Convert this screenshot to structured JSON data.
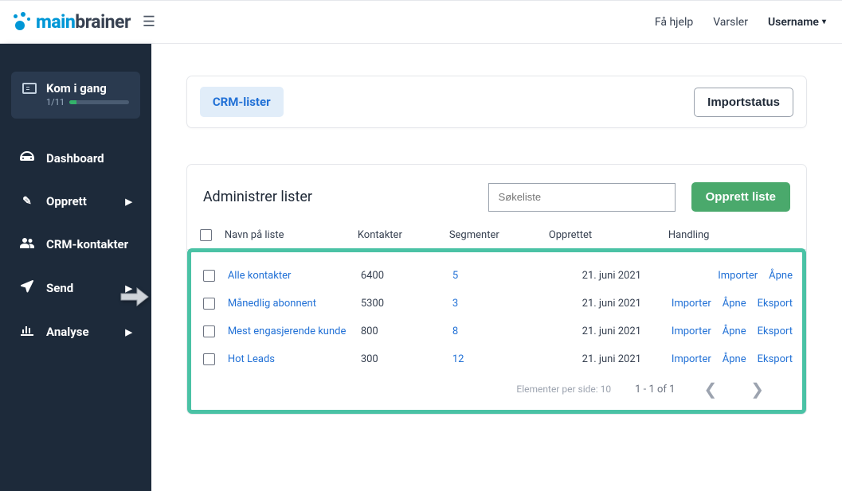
{
  "brand": {
    "part1": "main",
    "part2": "brainer"
  },
  "topbar": {
    "help": "Få hjelp",
    "alerts": "Varsler",
    "user": "Username"
  },
  "onboard": {
    "title": "Kom i gang",
    "progress": "1/11"
  },
  "nav": {
    "dashboard": "Dashboard",
    "create": "Opprett",
    "crm": "CRM-kontakter",
    "send": "Send",
    "analyse": "Analyse"
  },
  "header": {
    "pill": "CRM-lister",
    "import_status": "Importstatus"
  },
  "panel": {
    "title": "Administrer lister",
    "search_placeholder": "Søkeliste",
    "create_btn": "Opprett liste"
  },
  "columns": {
    "name": "Navn på liste",
    "contacts": "Kontakter",
    "segments": "Segmenter",
    "created": "Opprettet",
    "action": "Handling"
  },
  "actions": {
    "import": "Importer",
    "open": "Åpne",
    "export": "Eksport"
  },
  "rows": [
    {
      "name": "Alle kontakter",
      "contacts": "6400",
      "segments": "5",
      "created": "21. juni 2021",
      "has_export": false
    },
    {
      "name": "Månedlig abonnent",
      "contacts": "5300",
      "segments": "3",
      "created": "21. juni 2021",
      "has_export": true
    },
    {
      "name": "Mest engasjerende kunde",
      "contacts": "800",
      "segments": "8",
      "created": "21. juni 2021",
      "has_export": true
    },
    {
      "name": "Hot Leads",
      "contacts": "300",
      "segments": "12",
      "created": "21. juni 2021",
      "has_export": true
    }
  ],
  "pager": {
    "label": "Elementer per side: 10",
    "range": "1 - 1 of 1"
  }
}
